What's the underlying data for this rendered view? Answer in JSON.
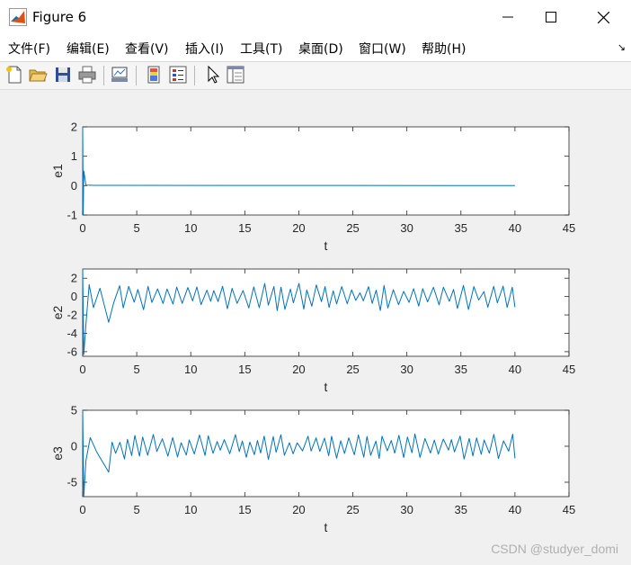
{
  "window": {
    "title": "Figure 6"
  },
  "menu": [
    {
      "label": "文件(F)"
    },
    {
      "label": "编辑(E)"
    },
    {
      "label": "查看(V)"
    },
    {
      "label": "插入(I)"
    },
    {
      "label": "工具(T)"
    },
    {
      "label": "桌面(D)"
    },
    {
      "label": "窗口(W)"
    },
    {
      "label": "帮助(H)"
    }
  ],
  "toolbar": {
    "icons": [
      "new-figure-icon",
      "open-file-icon",
      "save-icon",
      "print-icon",
      "link-plot-icon",
      "insert-colorbar-icon",
      "insert-legend-icon",
      "edit-plot-icon",
      "property-inspector-icon"
    ]
  },
  "watermark": "CSDN @studyer_domi",
  "chart_data": [
    {
      "type": "line",
      "ylabel": "e1",
      "xlabel": "t",
      "xlim": [
        0,
        45
      ],
      "ylim": [
        -1,
        2
      ],
      "xticks": [
        "0",
        "5",
        "10",
        "15",
        "20",
        "25",
        "30",
        "35",
        "40",
        "45"
      ],
      "yticks": [
        "-1",
        "0",
        "1",
        "2"
      ],
      "ytick_values": [
        -1,
        0,
        1,
        2
      ],
      "series": [
        {
          "t_range": [
            0,
            40
          ],
          "color": "#0072bd",
          "description_points": [
            [
              0,
              2
            ],
            [
              0.05,
              -1
            ],
            [
              0.1,
              0.5
            ],
            [
              0.3,
              0.02
            ],
            [
              1,
              0.01
            ],
            [
              40,
              0
            ]
          ]
        }
      ]
    },
    {
      "type": "line",
      "ylabel": "e2",
      "xlabel": "t",
      "xlim": [
        0,
        45
      ],
      "ylim": [
        -6.5,
        3
      ],
      "xticks": [
        "0",
        "5",
        "10",
        "15",
        "20",
        "25",
        "30",
        "35",
        "40",
        "45"
      ],
      "yticks": [
        "-6",
        "-4",
        "-2",
        "0",
        "2"
      ],
      "ytick_values": [
        -6,
        -4,
        -2,
        0,
        2
      ],
      "series": [
        {
          "t_range": [
            0,
            40
          ],
          "color": "#0072bd",
          "approx_amplitude": 1.3,
          "approx_period": 0.8,
          "initial_points": [
            [
              0,
              3
            ],
            [
              0.1,
              -6.3
            ],
            [
              0.3,
              -3
            ],
            [
              0.6,
              1.3
            ],
            [
              1.0,
              -1.2
            ],
            [
              1.6,
              0.9
            ],
            [
              2.4,
              -2.8
            ]
          ]
        }
      ]
    },
    {
      "type": "line",
      "ylabel": "e3",
      "xlabel": "t",
      "xlim": [
        0,
        45
      ],
      "ylim": [
        -7,
        5
      ],
      "xticks": [
        "0",
        "5",
        "10",
        "15",
        "20",
        "25",
        "30",
        "35",
        "40",
        "45"
      ],
      "yticks": [
        "-5",
        "0",
        "5"
      ],
      "ytick_values": [
        -5,
        0,
        5
      ],
      "series": [
        {
          "t_range": [
            0,
            40
          ],
          "color": "#0072bd",
          "approx_amplitude": 1.6,
          "approx_period": 0.75,
          "initial_points": [
            [
              0,
              5
            ],
            [
              0.1,
              -7
            ],
            [
              0.3,
              -2
            ],
            [
              0.7,
              1.2
            ],
            [
              1.3,
              -0.8
            ],
            [
              2.4,
              -3.6
            ]
          ]
        }
      ]
    }
  ]
}
